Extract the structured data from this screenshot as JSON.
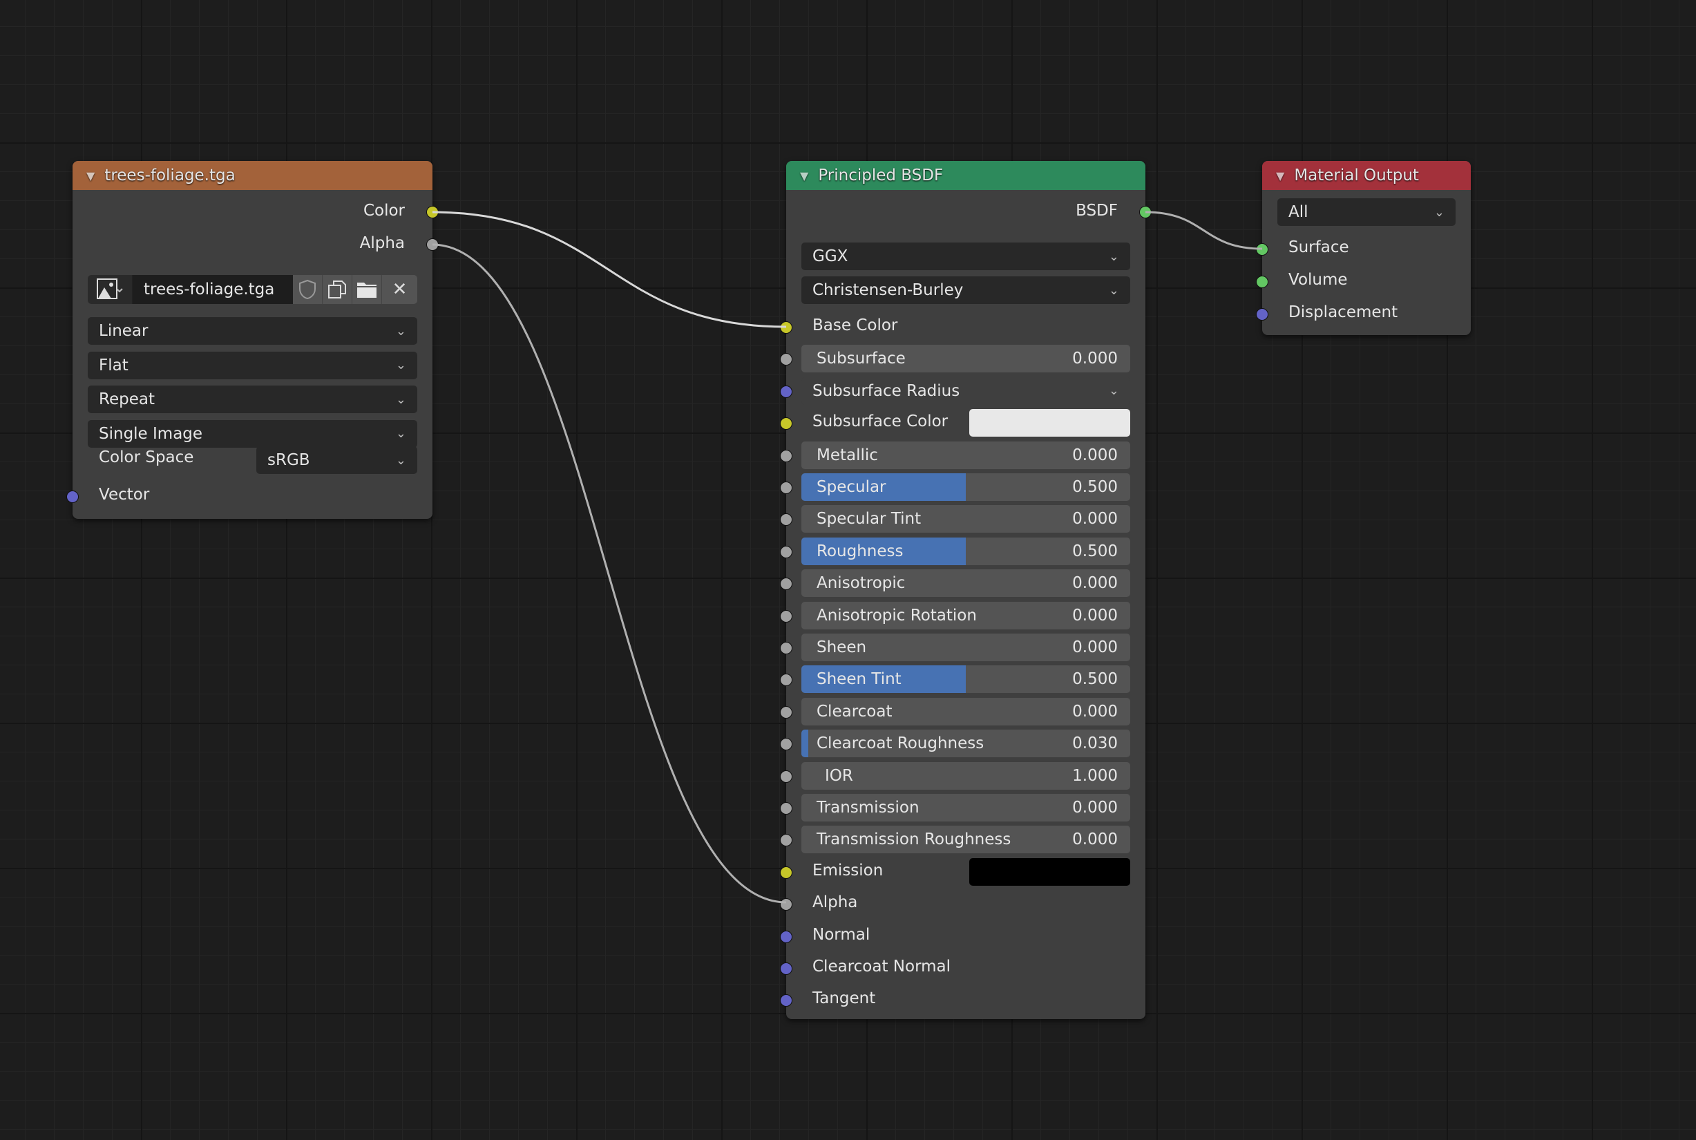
{
  "colors": {
    "image_header": "#a3623a",
    "bsdf_header": "#2d8a5c",
    "output_header": "#a3313b",
    "socket_color": "#c7c729",
    "socket_float": "#a1a1a1",
    "socket_vector": "#6363c7",
    "socket_shader": "#63c763",
    "slider_fill": "#4772b3"
  },
  "image_node": {
    "title": "trees-foliage.tga",
    "outputs": [
      "Color",
      "Alpha"
    ],
    "file_name": "trees-foliage.tga",
    "dropdowns": [
      "Linear",
      "Flat",
      "Repeat",
      "Single Image"
    ],
    "color_space_label": "Color Space",
    "color_space_value": "sRGB",
    "input_vector": "Vector"
  },
  "bsdf_node": {
    "title": "Principled BSDF",
    "output": "BSDF",
    "distribution": "GGX",
    "subsurface_method": "Christensen-Burley",
    "inputs": [
      {
        "label": "Base Color",
        "type": "socket",
        "socket": "color"
      },
      {
        "label": "Subsurface",
        "type": "slider",
        "value": "0.000",
        "fill": 0,
        "socket": "float"
      },
      {
        "label": "Subsurface Radius",
        "type": "dropdown",
        "socket": "vector"
      },
      {
        "label": "Subsurface Color",
        "type": "color",
        "swatch": "#e8e8e8",
        "socket": "color"
      },
      {
        "label": "Metallic",
        "type": "slider",
        "value": "0.000",
        "fill": 0,
        "socket": "float"
      },
      {
        "label": "Specular",
        "type": "slider",
        "value": "0.500",
        "fill": 0.5,
        "socket": "float"
      },
      {
        "label": "Specular Tint",
        "type": "slider",
        "value": "0.000",
        "fill": 0,
        "socket": "float"
      },
      {
        "label": "Roughness",
        "type": "slider",
        "value": "0.500",
        "fill": 0.5,
        "socket": "float"
      },
      {
        "label": "Anisotropic",
        "type": "slider",
        "value": "0.000",
        "fill": 0,
        "socket": "float"
      },
      {
        "label": "Anisotropic Rotation",
        "type": "slider",
        "value": "0.000",
        "fill": 0,
        "socket": "float"
      },
      {
        "label": "Sheen",
        "type": "slider",
        "value": "0.000",
        "fill": 0,
        "socket": "float"
      },
      {
        "label": "Sheen Tint",
        "type": "slider",
        "value": "0.500",
        "fill": 0.5,
        "socket": "float"
      },
      {
        "label": "Clearcoat",
        "type": "slider",
        "value": "0.000",
        "fill": 0,
        "socket": "float"
      },
      {
        "label": "Clearcoat Roughness",
        "type": "slider",
        "value": "0.030",
        "fill": 0.03,
        "socket": "float"
      },
      {
        "label": "IOR",
        "type": "number",
        "value": "1.000",
        "socket": "float"
      },
      {
        "label": "Transmission",
        "type": "slider",
        "value": "0.000",
        "fill": 0,
        "socket": "float"
      },
      {
        "label": "Transmission Roughness",
        "type": "slider",
        "value": "0.000",
        "fill": 0,
        "socket": "float"
      },
      {
        "label": "Emission",
        "type": "color",
        "swatch": "#000000",
        "socket": "color"
      },
      {
        "label": "Alpha",
        "type": "socket",
        "socket": "float"
      },
      {
        "label": "Normal",
        "type": "socket",
        "socket": "vector"
      },
      {
        "label": "Clearcoat Normal",
        "type": "socket",
        "socket": "vector"
      },
      {
        "label": "Tangent",
        "type": "socket",
        "socket": "vector"
      }
    ]
  },
  "output_node": {
    "title": "Material Output",
    "target": "All",
    "inputs": [
      {
        "label": "Surface",
        "socket": "shader"
      },
      {
        "label": "Volume",
        "socket": "shader"
      },
      {
        "label": "Displacement",
        "socket": "vector"
      }
    ]
  }
}
